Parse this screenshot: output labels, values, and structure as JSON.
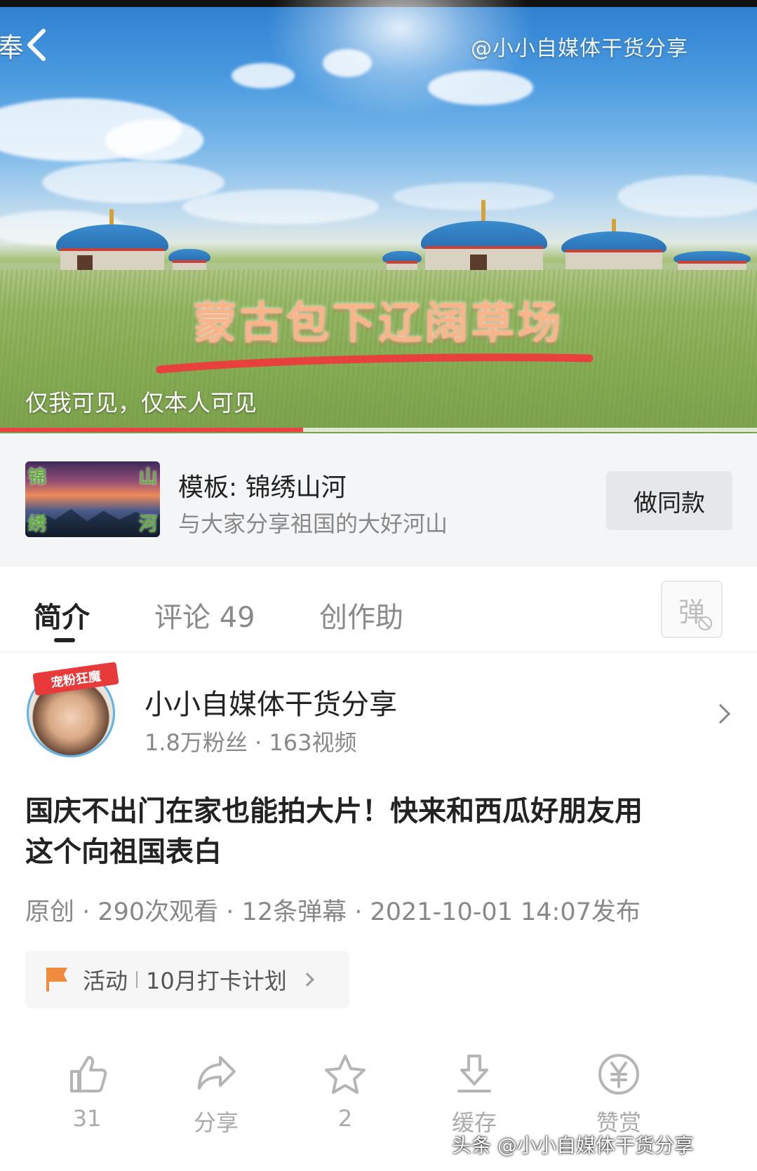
{
  "video": {
    "back_text": "奉",
    "watermark": "@小小自媒体干货分享",
    "caption": "蒙古包下辽阔草场",
    "privacy": "仅我可见，仅本人可见",
    "progress_fraction": 0.4
  },
  "template": {
    "thumb_chars": [
      "锦",
      "山",
      "绣",
      "河"
    ],
    "title": "模板: 锦绣山河",
    "description": "与大家分享祖国的大好河山",
    "button": "做同款"
  },
  "tabs": {
    "items": [
      "简介",
      "评论 49",
      "创作助"
    ],
    "active": 0,
    "danmaku_label": "弹"
  },
  "author": {
    "badge": "宠粉狂魔",
    "name": "小小自媒体干货分享",
    "stats": "1.8万粉丝 · 163视频"
  },
  "post": {
    "title": "国庆不出门在家也能拍大片！快来和西瓜好朋友用这个向祖国表白",
    "meta": "原创 · 290次观看 · 12条弹幕 · 2021-10-01 14:07发布"
  },
  "activity": {
    "label": "活动",
    "text": "10月打卡计划"
  },
  "actions": {
    "like": "31",
    "share": "分享",
    "favorite": "2",
    "download": "缓存",
    "reward": "赞赏"
  },
  "footer_watermark": "头条 @小小自媒体干货分享",
  "colors": {
    "accent_red": "#f04142",
    "caption_orange": "#f9b48a",
    "flag_orange": "#f08a3c"
  }
}
